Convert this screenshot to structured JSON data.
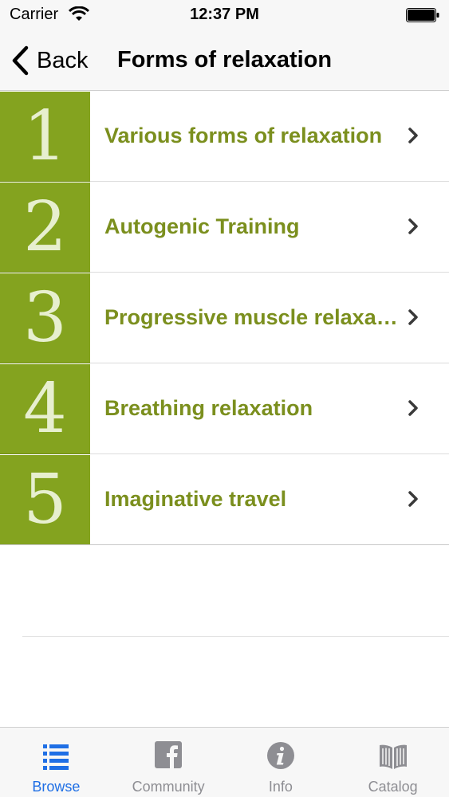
{
  "status_bar": {
    "carrier": "Carrier",
    "time": "12:37 PM"
  },
  "nav": {
    "back_label": "Back",
    "title": "Forms of relaxation"
  },
  "items": [
    {
      "number": "1",
      "label": "Various forms of relaxation"
    },
    {
      "number": "2",
      "label": "Autogenic Training"
    },
    {
      "number": "3",
      "label": "Progressive muscle relaxation"
    },
    {
      "number": "4",
      "label": "Breathing relaxation"
    },
    {
      "number": "5",
      "label": "Imaginative travel"
    }
  ],
  "tabs": [
    {
      "label": "Browse",
      "icon": "list-icon",
      "active": true
    },
    {
      "label": "Community",
      "icon": "facebook-icon",
      "active": false
    },
    {
      "label": "Info",
      "icon": "info-icon",
      "active": false
    },
    {
      "label": "Catalog",
      "icon": "book-icon",
      "active": false
    }
  ],
  "colors": {
    "accent_green": "#84a31f",
    "text_green": "#7b8f1e",
    "tab_active": "#1f6fe5",
    "tab_inactive": "#8e8e93"
  }
}
